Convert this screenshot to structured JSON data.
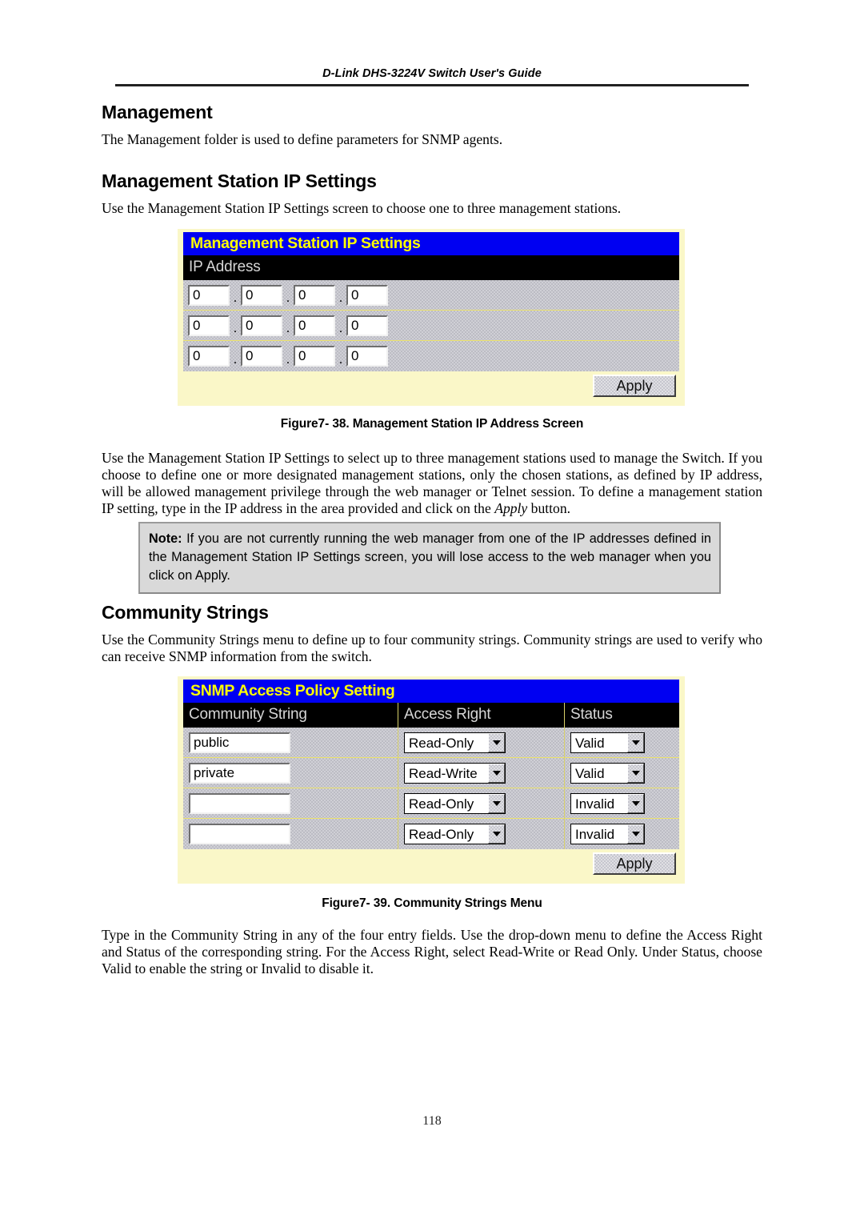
{
  "header": {
    "running_title": "D-Link DHS-3224V Switch User's Guide"
  },
  "sections": {
    "management_heading": "Management",
    "management_intro": "The Management folder is used to define parameters for SNMP agents.",
    "station_heading": "Management Station IP Settings",
    "station_intro": "Use the Management Station IP Settings screen to choose one to three management stations.",
    "station_body": "Use the Management Station IP Settings to select up to three management stations used to manage the Switch. If you choose to define one or more designated management stations, only the chosen stations, as defined by IP address, will be allowed management privilege through the web manager or Telnet session. To define a management station IP setting, type in the IP address in the area provided and click on the ",
    "station_body_italic": "Apply",
    "station_body_tail": " button.",
    "community_heading": "Community Strings",
    "community_intro": "Use the Community Strings menu to define up to four community strings. Community strings are used to verify who can receive SNMP information from the switch.",
    "community_body": "Type in the Community String in any of the four entry fields. Use the drop-down menu to define the Access Right and Status of the corresponding string. For the Access Right, select Read-Write or Read Only. Under Status, choose Valid to enable the string or Invalid to disable it."
  },
  "note": {
    "label": "Note:",
    "text": " If you are not currently running the web manager from one of the IP addresses defined in the Management Station IP Settings screen, you will lose access to the web manager when you click on Apply."
  },
  "figure1": {
    "caption": "Figure7- 38. Management Station IP Address Screen",
    "title_bar": "Management Station IP Settings",
    "column_header": "IP Address",
    "apply_label": "Apply",
    "octet_separator": ".",
    "rows": [
      {
        "octets": [
          "0",
          "0",
          "0",
          "0"
        ]
      },
      {
        "octets": [
          "0",
          "0",
          "0",
          "0"
        ]
      },
      {
        "octets": [
          "0",
          "0",
          "0",
          "0"
        ]
      }
    ],
    "colors": {
      "title_bg": "#0000f2",
      "title_fg": "#ffff00",
      "header_bg": "#000000",
      "header_fg": "#d6d6d6",
      "body_bg": "#bcbcc4",
      "frame_bg": "#faf7c8"
    }
  },
  "figure2": {
    "caption": "Figure7- 39. Community Strings Menu",
    "title_bar": "SNMP Access Policy Setting",
    "columns": [
      "Community String",
      "Access Right",
      "Status"
    ],
    "apply_label": "Apply",
    "rows": [
      {
        "community_string": "public",
        "access_right": "Read-Only",
        "status": "Valid"
      },
      {
        "community_string": "private",
        "access_right": "Read-Write",
        "status": "Valid"
      },
      {
        "community_string": "",
        "access_right": "Read-Only",
        "status": "Invalid"
      },
      {
        "community_string": "",
        "access_right": "Read-Only",
        "status": "Invalid"
      }
    ],
    "colors": {
      "title_bg": "#0000f2",
      "title_fg": "#ffff00",
      "header_bg": "#000000",
      "header_fg": "#d6d6d6",
      "body_bg": "#bcbcc4",
      "frame_bg": "#faf7c8"
    }
  },
  "footer": {
    "page_number": "118"
  }
}
